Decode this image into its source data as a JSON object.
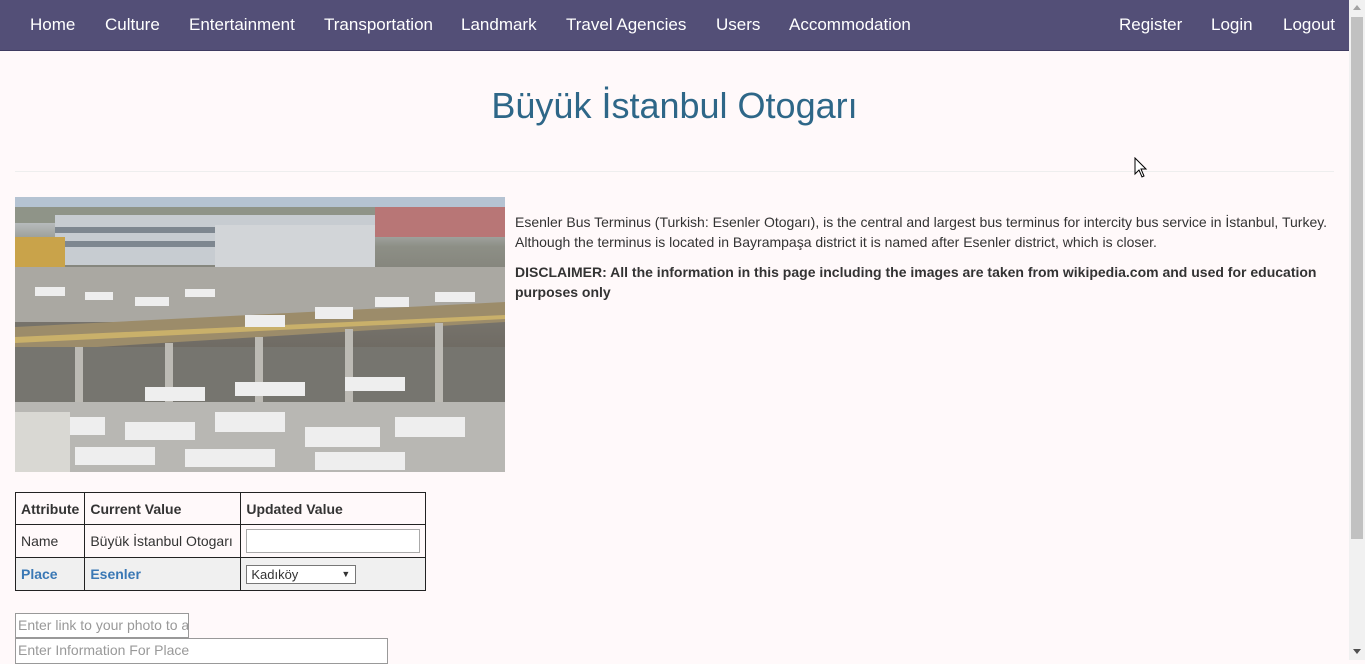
{
  "nav": {
    "left": [
      "Home",
      "Culture",
      "Entertainment",
      "Transportation",
      "Landmark",
      "Travel Agencies",
      "Users",
      "Accommodation"
    ],
    "right": [
      "Register",
      "Login",
      "Logout"
    ]
  },
  "page": {
    "title": "Büyük İstanbul Otogarı",
    "image_alt": "Esenler Bus Terminus photo",
    "description": "Esenler Bus Terminus (Turkish: Esenler Otogarı), is the central and largest bus terminus for intercity bus service in İstanbul, Turkey. Although the terminus is located in Bayrampaşa district it is named after Esenler district, which is closer.",
    "disclaimer": "DISCLAIMER: All the information in this page including the images are taken from wikipedia.com and used for education purposes only"
  },
  "table": {
    "headers": [
      "Attribute",
      "Current Value",
      "Updated Value"
    ],
    "name_row": {
      "attribute": "Name",
      "current": "Büyük İstanbul Otogarı",
      "updated": ""
    },
    "place_row": {
      "attribute": "Place",
      "current": "Esenler",
      "selected": "Kadıköy"
    }
  },
  "inputs": {
    "photo_link_placeholder": "Enter link to your photo to add",
    "info_placeholder": "Enter Information For Place"
  },
  "colors": {
    "nav_bg": "#534f77",
    "title": "#2e6788",
    "link": "#3a78b5",
    "page_bg": "#fff9fa"
  }
}
